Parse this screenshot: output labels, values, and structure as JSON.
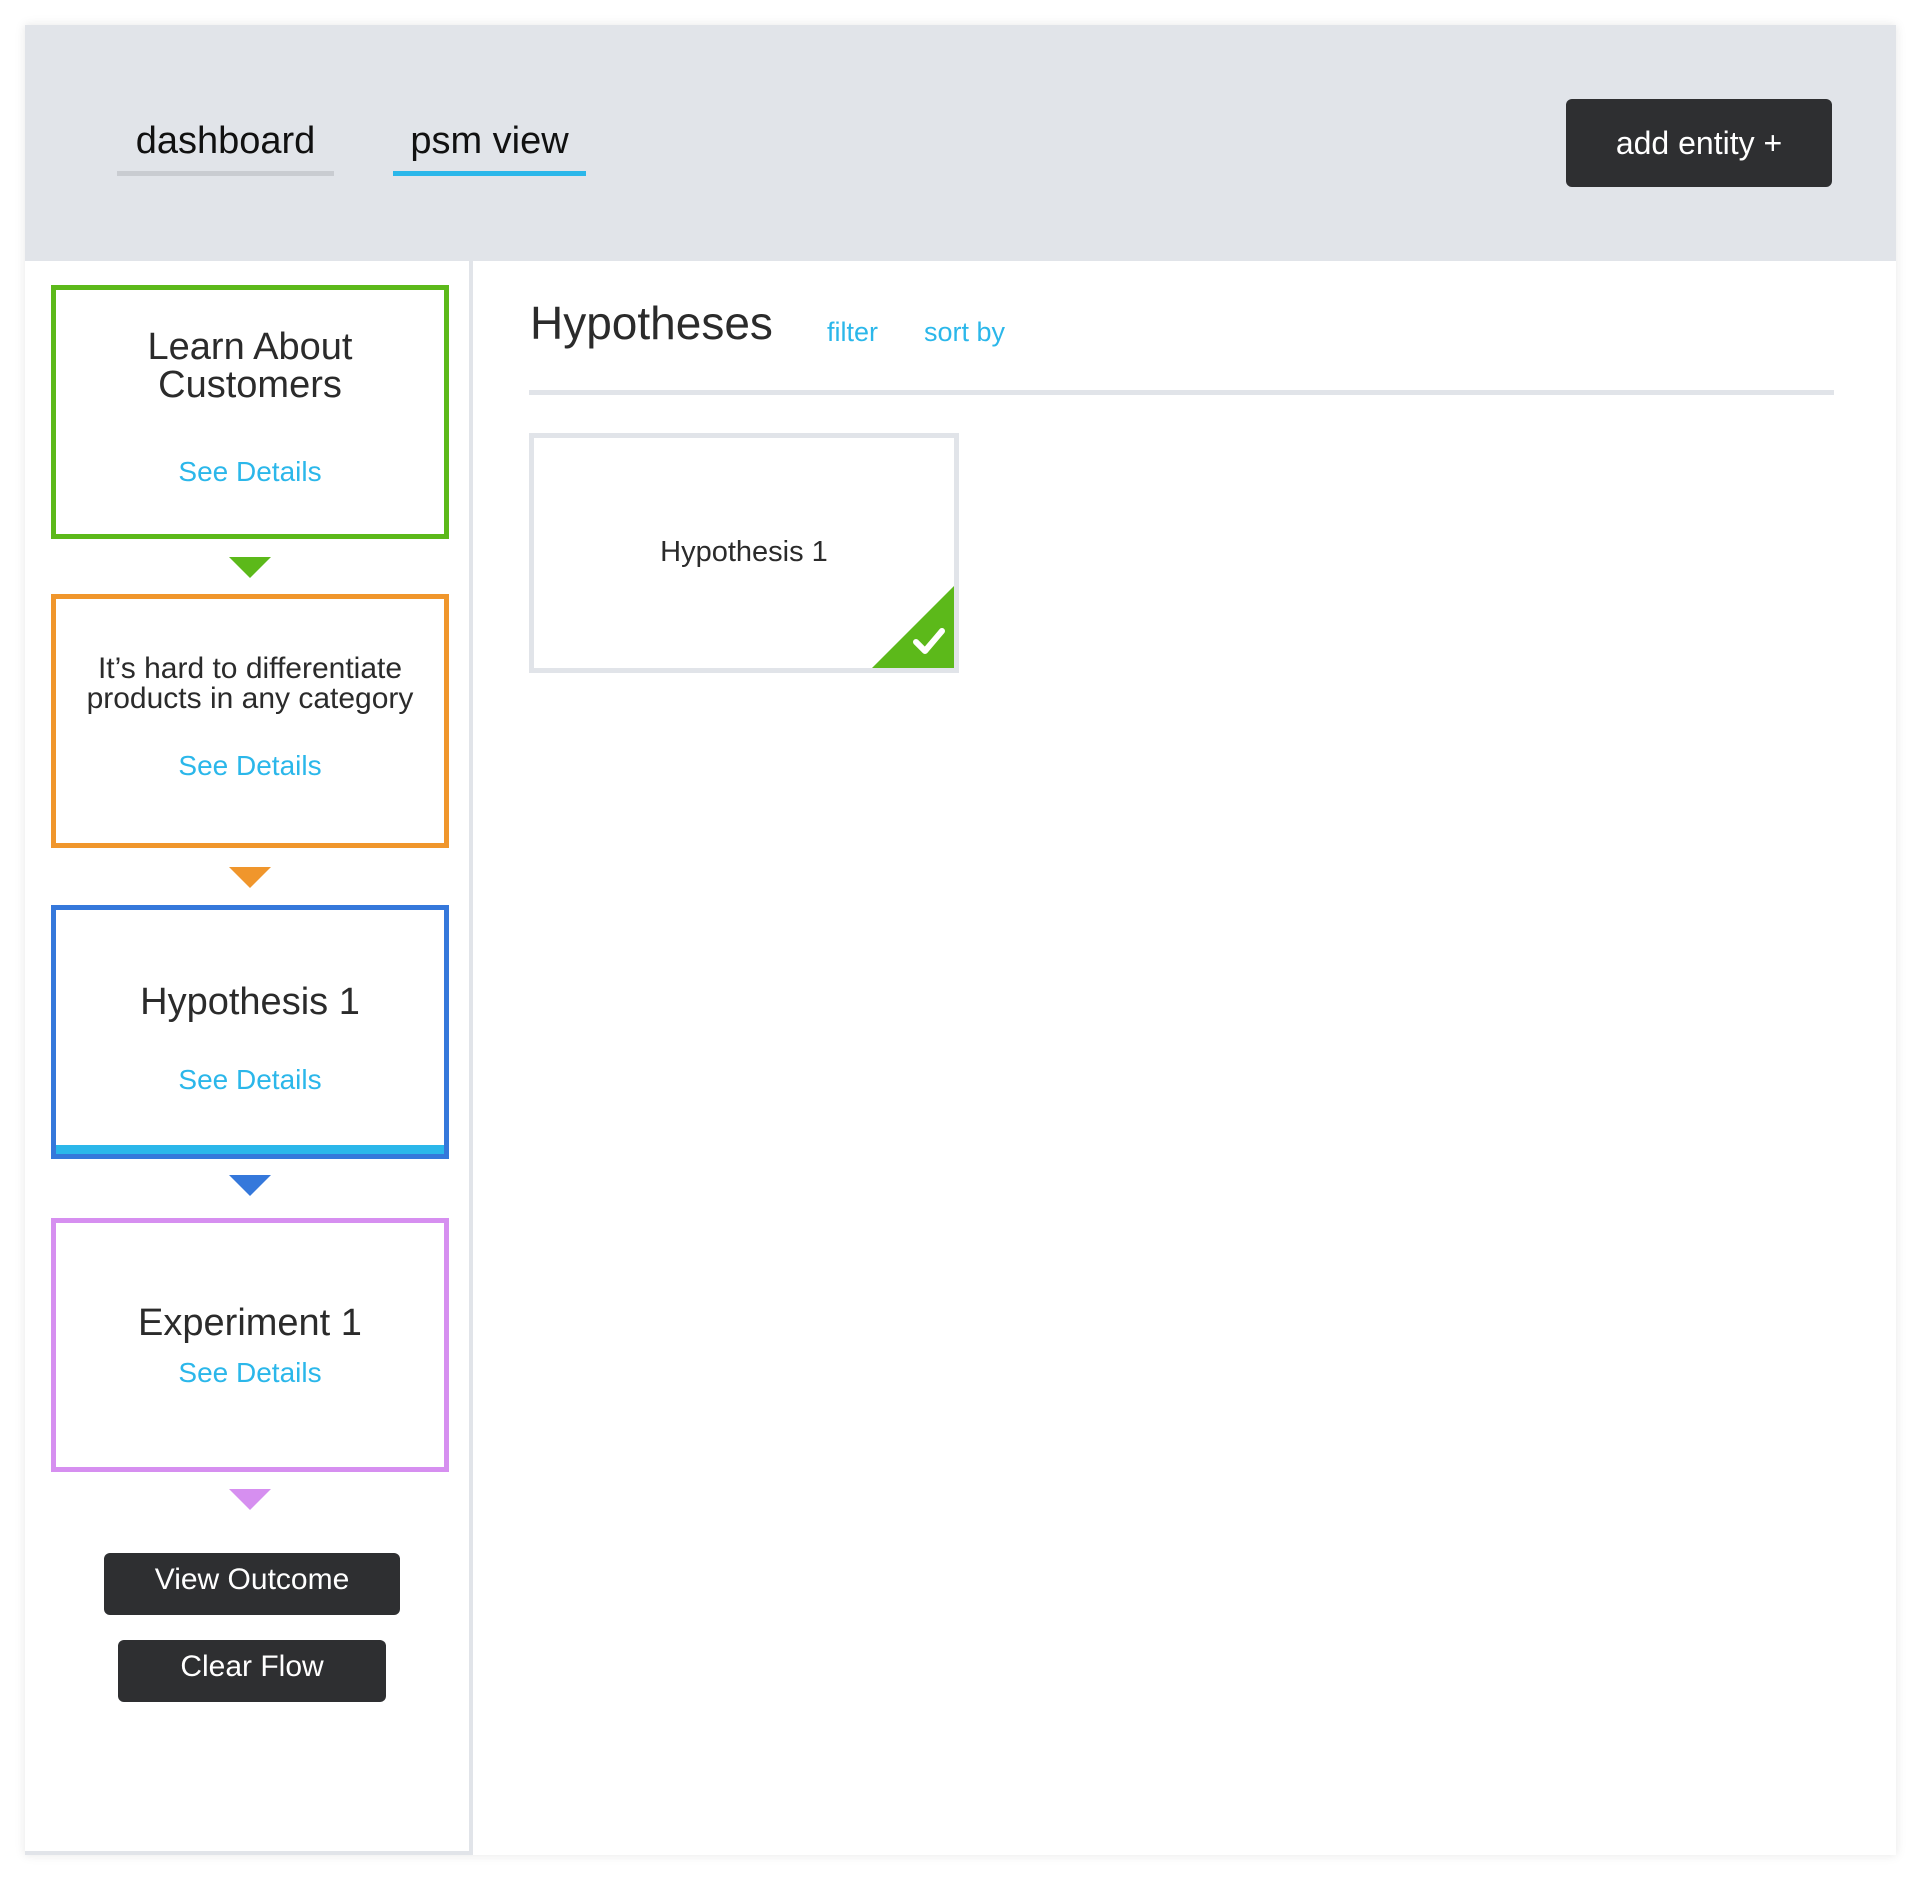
{
  "header": {
    "tabs": [
      {
        "label": "dashboard",
        "active": false
      },
      {
        "label": "psm view",
        "active": true
      }
    ],
    "add_entity_label": "add entity +"
  },
  "sidebar": {
    "cards": [
      {
        "title_lines": [
          "Learn About",
          "Customers"
        ],
        "link": "See Details",
        "color": "#5cb91a"
      },
      {
        "title_lines": [
          "It’s hard to differentiate",
          "products in any category"
        ],
        "link": "See Details",
        "color": "#f0962c"
      },
      {
        "title_lines": [
          "Hypothesis 1"
        ],
        "link": "See Details",
        "color": "#3578db",
        "active": true
      },
      {
        "title_lines": [
          "Experiment 1"
        ],
        "link": "See Details",
        "color": "#d68ff0"
      }
    ],
    "view_outcome_label": "View Outcome",
    "clear_flow_label": "Clear Flow"
  },
  "main": {
    "title": "Hypotheses",
    "filter_label": "filter",
    "sort_label": "sort by",
    "items": [
      {
        "title": "Hypothesis 1",
        "status_icon": "checkmark-icon",
        "status_color": "#5cb91a"
      }
    ]
  },
  "colors": {
    "accent": "#2bb7ea",
    "header_bg": "#e1e4e9",
    "button_dark": "#2e2f31"
  }
}
